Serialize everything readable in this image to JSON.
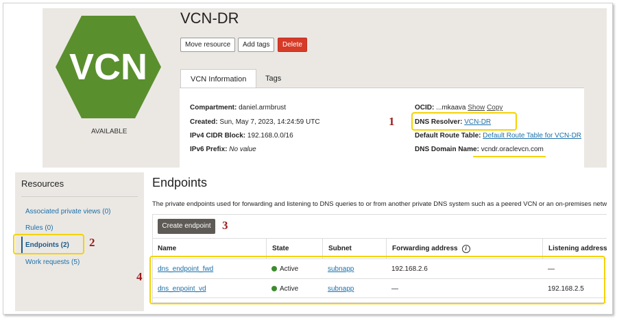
{
  "header": {
    "title": "VCN-DR",
    "logo_text": "VCN",
    "status": "AVAILABLE",
    "buttons": {
      "move": "Move resource",
      "tags": "Add tags",
      "delete": "Delete"
    },
    "tabs": [
      "VCN Information",
      "Tags"
    ]
  },
  "info": {
    "compartment": {
      "label": "Compartment:",
      "value": "daniel.armbrust"
    },
    "created": {
      "label": "Created:",
      "value": "Sun, May 7, 2023, 14:24:59 UTC"
    },
    "ipv4": {
      "label": "IPv4 CIDR Block:",
      "value": "192.168.0.0/16"
    },
    "ipv6": {
      "label": "IPv6 Prefix:",
      "value": "No value"
    },
    "ocid": {
      "label": "OCID:",
      "value": "...mkaava",
      "show": "Show",
      "copy": "Copy"
    },
    "dns_resolver": {
      "label": "DNS Resolver:",
      "value": "VCN-DR"
    },
    "route_table": {
      "label": "Default Route Table:",
      "value": "Default Route Table for VCN-DR"
    },
    "dns_domain": {
      "label": "DNS Domain Name:",
      "value": "vcndr.oraclevcn.com"
    }
  },
  "resources": {
    "title": "Resources",
    "items": [
      "Associated private views (0)",
      "Rules (0)",
      "Endpoints (2)",
      "Work requests (5)"
    ]
  },
  "endpoints": {
    "title": "Endpoints",
    "description": "The private endpoints used for forwarding and listening to DNS queries to or from another private DNS system such as a peered VCN or an on-premises network.",
    "create_label": "Create endpoint",
    "columns": [
      "Name",
      "State",
      "Subnet",
      "Forwarding address",
      "Listening address"
    ],
    "rows": [
      {
        "name": "dns_endpoint_fwd",
        "state": "Active",
        "subnet": "subnapp",
        "forwarding": "192.168.2.6",
        "listening": "—"
      },
      {
        "name": "dns_enpoint_vd",
        "state": "Active",
        "subnet": "subnapp",
        "forwarding": "—",
        "listening": "192.168.2.5"
      }
    ]
  },
  "annotations": [
    "1",
    "2",
    "3",
    "4"
  ],
  "colors": {
    "brand_green": "#5a8f2e",
    "delete": "#d63b28",
    "annotation_box": "#f4d300",
    "annotation_num": "#9b1b1b"
  }
}
